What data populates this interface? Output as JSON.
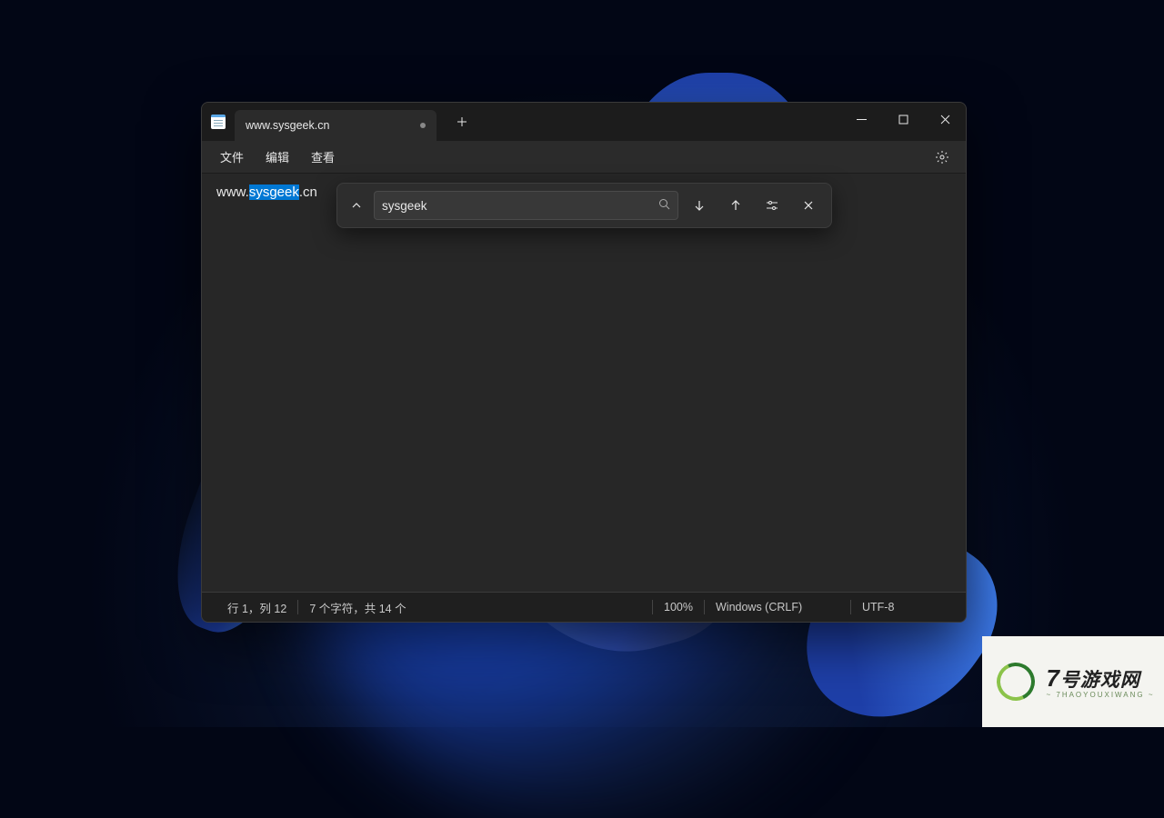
{
  "tab": {
    "title": "www.sysgeek.cn"
  },
  "menu": {
    "file": "文件",
    "edit": "编辑",
    "view": "查看"
  },
  "editor": {
    "text_before": "www.",
    "text_highlight": "sysgeek",
    "text_after": ".cn"
  },
  "find": {
    "query": "sysgeek"
  },
  "status": {
    "position": "行 1，列 12",
    "chars": "7 个字符，共 14 个",
    "zoom": "100%",
    "line_ending": "Windows (CRLF)",
    "encoding": "UTF-8"
  },
  "watermark": {
    "number": "7",
    "text": "号游戏网",
    "sub": "~ 7HAOYOUXIWANG ~"
  }
}
